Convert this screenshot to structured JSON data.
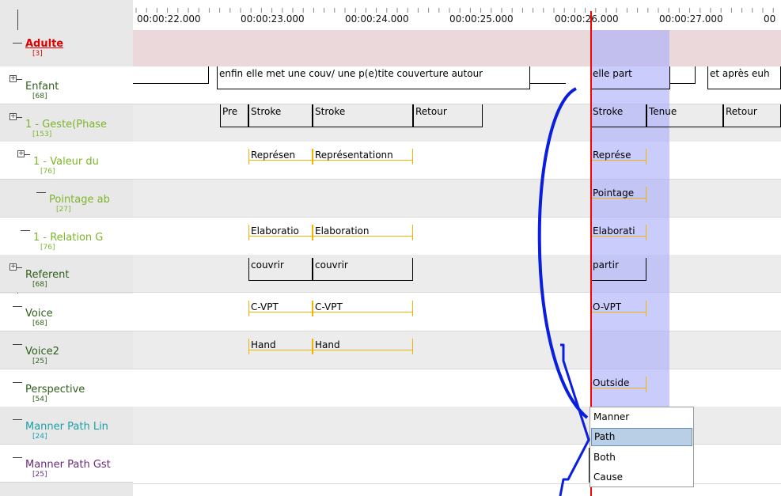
{
  "timeline": {
    "ticks": [
      "00:00:22.000",
      "00:00:23.000",
      "00:00:24.000",
      "00:00:25.000",
      "00:00:26.000",
      "00:00:27.000",
      "00"
    ]
  },
  "tiers": [
    {
      "name": "Adulte",
      "count": "[3]",
      "color": "#e00000",
      "expander": false
    },
    {
      "name": "Enfant",
      "count": "[68]",
      "color": "#2d5f1a",
      "expander": true
    },
    {
      "name": "1 - Geste(Phase",
      "count": "[153]",
      "color": "#7cb52a",
      "expander": true
    },
    {
      "name": "1 - Valeur du",
      "count": "[76]",
      "color": "#7cb52a",
      "expander": true
    },
    {
      "name": "Pointage ab",
      "count": "[27]",
      "color": "#7cb52a",
      "expander": false
    },
    {
      "name": "1 - Relation G",
      "count": "[76]",
      "color": "#7cb52a",
      "expander": false
    },
    {
      "name": "Referent",
      "count": "[68]",
      "color": "#2d5f1a",
      "expander": true
    },
    {
      "name": "Voice",
      "count": "[68]",
      "color": "#2d5f1a",
      "expander": false
    },
    {
      "name": "Voice2",
      "count": "[25]",
      "color": "#2d5f1a",
      "expander": false
    },
    {
      "name": "Perspective",
      "count": "[54]",
      "color": "#2d5f1a",
      "expander": false
    },
    {
      "name": "Manner Path Lin",
      "count": "[24]",
      "color": "#1aa0a8",
      "expander": false
    },
    {
      "name": "Manner Path Gst",
      "count": "[25]",
      "color": "#6a2a7a",
      "expander": false
    }
  ],
  "annotations": {
    "enfant": [
      "enfin elle met une couv/ une p(e)tite couverture autour",
      "elle part",
      "et après euh"
    ],
    "geste": [
      "Pre",
      "Stroke",
      "Stroke",
      "Retour",
      "Stroke",
      "Tenue",
      "Retour"
    ],
    "valeur": [
      "Représen",
      "Représentationn",
      "Représe"
    ],
    "pointage": [
      "Pointage"
    ],
    "relation": [
      "Elaboratio",
      "Elaboration",
      "Elaborati"
    ],
    "referent": [
      "couvrir",
      "couvrir",
      "partir"
    ],
    "voice": [
      "C-VPT",
      "C-VPT",
      "O-VPT"
    ],
    "voice2": [
      "Hand",
      "Hand"
    ],
    "perspective": [
      "Outside"
    ]
  },
  "dropdown": {
    "options": [
      "Manner",
      "Path",
      "Both",
      "Cause"
    ],
    "selected": "Path"
  },
  "colors": {
    "crosshair": "#ff0000",
    "selection": "#c7c9fa",
    "arrow": "#0a1ee0",
    "adulte_band": "#ead8da"
  }
}
